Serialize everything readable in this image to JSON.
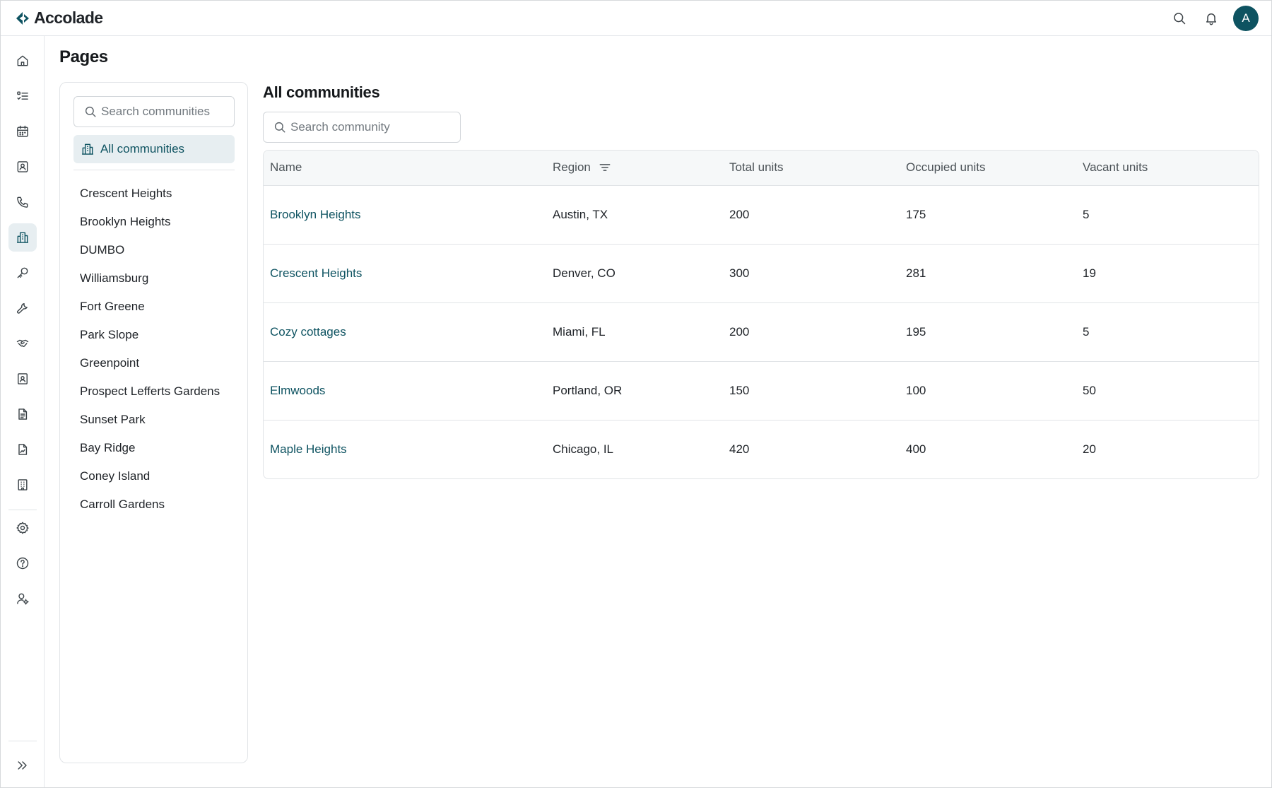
{
  "app": {
    "name": "Accolade"
  },
  "header": {
    "avatar_initial": "A"
  },
  "rail": {
    "items": [
      {
        "name": "home"
      },
      {
        "name": "tasks"
      },
      {
        "name": "calendar"
      },
      {
        "name": "contacts"
      },
      {
        "name": "calls"
      },
      {
        "name": "communities",
        "active": true
      },
      {
        "name": "keys"
      },
      {
        "name": "maintenance"
      },
      {
        "name": "handshake"
      },
      {
        "name": "directory"
      },
      {
        "name": "documents"
      },
      {
        "name": "reports"
      },
      {
        "name": "buildings"
      }
    ],
    "bottom_items": [
      {
        "name": "settings"
      },
      {
        "name": "help"
      },
      {
        "name": "user-settings"
      }
    ],
    "expand": {
      "name": "expand"
    }
  },
  "page": {
    "title": "Pages"
  },
  "panel": {
    "search_placeholder": "Search communities",
    "all_label": "All communities",
    "communities": [
      "Crescent Heights",
      "Brooklyn Heights",
      "DUMBO",
      "Williamsburg",
      "Fort Greene",
      "Park Slope",
      "Greenpoint",
      "Prospect Lefferts Gardens",
      "Sunset Park",
      "Bay Ridge",
      "Coney Island",
      "Carroll Gardens"
    ]
  },
  "main": {
    "title": "All communities",
    "search_placeholder": "Search community",
    "table": {
      "columns": [
        "Name",
        "Region",
        "Total units",
        "Occupied units",
        "Vacant units"
      ],
      "rows": [
        {
          "name": "Brooklyn Heights",
          "region": "Austin, TX",
          "total": "200",
          "occupied": "175",
          "vacant": "5"
        },
        {
          "name": "Crescent Heights",
          "region": "Denver, CO",
          "total": "300",
          "occupied": "281",
          "vacant": "19"
        },
        {
          "name": "Cozy cottages",
          "region": "Miami, FL",
          "total": "200",
          "occupied": "195",
          "vacant": "5"
        },
        {
          "name": "Elmwoods",
          "region": "Portland, OR",
          "total": "150",
          "occupied": "100",
          "vacant": "50"
        },
        {
          "name": "Maple Heights",
          "region": "Chicago, IL",
          "total": "420",
          "occupied": "400",
          "vacant": "20"
        }
      ]
    }
  },
  "colors": {
    "brand": "#0e5361",
    "active_bg": "#e7eef1",
    "border": "#e1e4e7",
    "header_bg": "#f6f8f9"
  }
}
